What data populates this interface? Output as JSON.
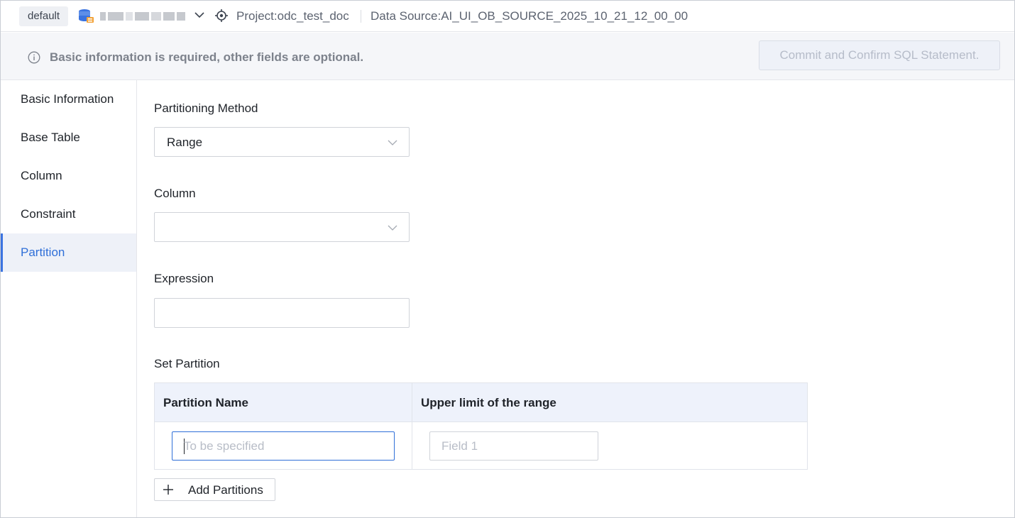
{
  "topbar": {
    "environment": "default",
    "database_name_redacted": true,
    "project": "Project:odc_test_doc",
    "data_source": "Data Source:AI_UI_OB_SOURCE_2025_10_21_12_00_00"
  },
  "notice": {
    "text": "Basic information is required, other fields are optional.",
    "commit_button": "Commit and Confirm SQL Statement."
  },
  "sidebar": {
    "items": [
      {
        "label": "Basic Information",
        "active": false
      },
      {
        "label": "Base Table",
        "active": false
      },
      {
        "label": "Column",
        "active": false
      },
      {
        "label": "Constraint",
        "active": false
      },
      {
        "label": "Partition",
        "active": true
      }
    ]
  },
  "form": {
    "partitioning_method": {
      "label": "Partitioning Method",
      "value": "Range"
    },
    "column": {
      "label": "Column",
      "value": ""
    },
    "expression": {
      "label": "Expression",
      "value": ""
    },
    "set_partition": {
      "label": "Set Partition",
      "columns": [
        "Partition Name",
        "Upper limit of the range"
      ],
      "rows": [
        {
          "name_placeholder": "To be specified",
          "limit_placeholder": "Field 1"
        }
      ],
      "add_button": "Add Partitions"
    }
  },
  "colors": {
    "accent": "#2f6fd8",
    "active_bg": "#eef1f8",
    "table_header_bg": "#eef2fb",
    "disabled_text": "#b6bcc9"
  },
  "icons": [
    "database-icon",
    "chevron-down-icon",
    "locate-icon",
    "info-icon",
    "plus-icon"
  ]
}
